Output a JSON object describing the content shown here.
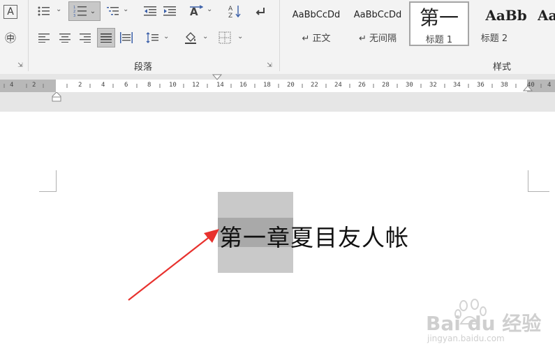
{
  "ribbon": {
    "paragraph_group_label": "段落",
    "styles_group_label": "样式",
    "dropdown_glyph": "⌄",
    "launcher_glyph": "⇲",
    "left_buttons": {
      "char_shading": "A",
      "enclose_char": "㊥"
    },
    "styles": [
      {
        "sample": "AaBbCcDd",
        "name": "↵ 正文",
        "selected": false
      },
      {
        "sample": "AaBbCcDd",
        "name": "↵ 无间隔",
        "selected": false
      },
      {
        "sample": "第一",
        "name": "标题 1",
        "selected": true
      },
      {
        "sample": "AaBb",
        "name": "标题 2",
        "selected": false
      },
      {
        "sample": "Aa",
        "name": "",
        "selected": false
      }
    ]
  },
  "ruler": {
    "left_labels": [
      "4",
      "2"
    ],
    "labels": [
      "2",
      "4",
      "6",
      "8",
      "10",
      "12",
      "14",
      "16",
      "18",
      "20",
      "22",
      "24",
      "26",
      "28",
      "30",
      "32",
      "34",
      "36",
      "38",
      "40",
      "4"
    ]
  },
  "document": {
    "heading": "第一章夏目友人帐"
  },
  "watermark": {
    "logo": "Bai du 经验",
    "url": "jingyan.baidu.com"
  },
  "colors": {
    "annotation_arrow": "#e8322e",
    "selection": "#c9c9c9",
    "selection_line": "#a9a9a9"
  }
}
